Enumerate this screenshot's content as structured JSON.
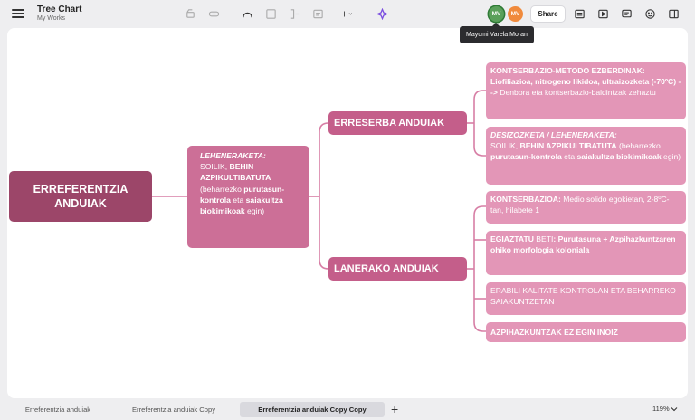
{
  "header": {
    "title": "Tree Chart",
    "subtitle": "My Works",
    "share_label": "Share",
    "tooltip": "Mayumi Varela Moran",
    "avatars": [
      {
        "initials": "MV",
        "color": "#5aa05a"
      },
      {
        "initials": "MV",
        "color": "#f08a3c"
      }
    ],
    "add_symbol": "+",
    "accent": "#7b4fe0"
  },
  "mindmap": {
    "root": "ERREFERENTZIA ANDUIAK",
    "level1": {
      "title": "LEHENERAKETA:",
      "l1": "SOILIK, ",
      "l1b": "BEHIN AZPIKULTIBATUTA",
      "l2": "(beharrezko ",
      "l2b": "purutasun-kontrola",
      "l3": " eta ",
      "l3b": "saiakultza biokimikoak",
      "l4": " egin)"
    },
    "branches": [
      {
        "label": "ERRESERBA ANDUIAK"
      },
      {
        "label": "LANERAKO ANDUIAK"
      }
    ],
    "leaves": {
      "n1_bold": "KONTSERBAZIO-METODO EZBERDINAK: Liofiliazioa, nitrogeno likidoa, ultraizozketa (-70ºC) -->",
      "n1_rest": " Denbora eta kontserbazio-baldintzak zehaztu",
      "n2_title": "DESIZOZKETA / LEHENERAKETA:",
      "n2_a": "SOILIK, ",
      "n2_ab": "BEHIN AZPIKULTIBATUTA",
      "n2_b": " (beharrezko ",
      "n2_bb": "purutasun-kontrola",
      "n2_c": " eta ",
      "n2_cb": "saiakultza biokimikoak",
      "n2_d": " egin)",
      "n3_bold": "KONTSERBAZIOA:",
      "n3_rest": " Medio solido egokietan, 2-8ºC-tan, hilabete 1",
      "n4_a": "EGIAZTATU ",
      "n4_bold": "BETI",
      "n4_rest": ": Purutasuna + Azpihazkuntzaren ohiko morfologia koloniala",
      "n5": "ERABILI KALITATE KONTROLAN ETA BEHARREKO SAIAKUNTZETAN",
      "n6": "AZPIHAZKUNTZAK EZ EGIN INOIZ"
    },
    "colors": {
      "root": "#9c4669",
      "level1": "#cc6f97",
      "branch": "#c45e8a",
      "leaf": "#e396b7",
      "line": "#d77ea5"
    }
  },
  "footer": {
    "tabs": [
      {
        "label": "Erreferentzia anduiak",
        "active": false
      },
      {
        "label": "Erreferentzia anduiak Copy",
        "active": false
      },
      {
        "label": "Erreferentzia anduiak Copy Copy",
        "active": true
      }
    ],
    "add_tab": "+",
    "zoom": "119%"
  }
}
